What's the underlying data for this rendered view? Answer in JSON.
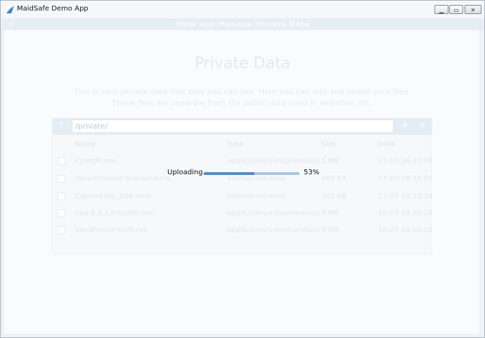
{
  "window": {
    "title": "MaidSafe Demo App",
    "controls": {
      "minimize_icon": "minimize-icon",
      "maximize_icon": "maximize-icon",
      "close_icon": "close-icon"
    }
  },
  "appbar": {
    "title": "View and Manage Private Data",
    "back_icon": "back-chevron-icon"
  },
  "page": {
    "heading": "Private Data",
    "description_line1": "This is your private data that only you can see. Here you can add and delete your files.",
    "description_line2": "These files are separate from the public data used in websites, etc."
  },
  "pathbar": {
    "path": "/private/"
  },
  "table": {
    "headers": {
      "name": "Name",
      "type": "Type",
      "size": "Size",
      "date": "Date"
    },
    "rows": [
      {
        "name": "CpWzPr.exe",
        "type": "application/x-msdownload",
        "size": "5 MB",
        "date": "17-07-16 22:49"
      },
      {
        "name": "decentralized domain.wmv",
        "type": "video/x-ms-wmv",
        "size": "865 KB",
        "date": "17-07-16 22:55"
      },
      {
        "name": "CaptureWiz_004.wmv",
        "type": "video/x-ms-wmv",
        "size": "362 KB",
        "date": "17-07-16 23:39"
      },
      {
        "name": "npp.6.3.2.Installer.exe",
        "type": "application/x-msdownload",
        "size": "4 MB",
        "date": "18-07-16 00:28"
      },
      {
        "name": "SandboxieInstall.exe",
        "type": "application/x-msdownload",
        "size": "9 MB",
        "date": "18-07-16 06:18"
      }
    ]
  },
  "upload": {
    "label": "Uploading",
    "percent_text": "53%",
    "progress": 0.53
  },
  "colors": {
    "progress_fill": "#5b8bb8",
    "progress_track": "#a9c6de",
    "appbar": "#e6eef4"
  }
}
